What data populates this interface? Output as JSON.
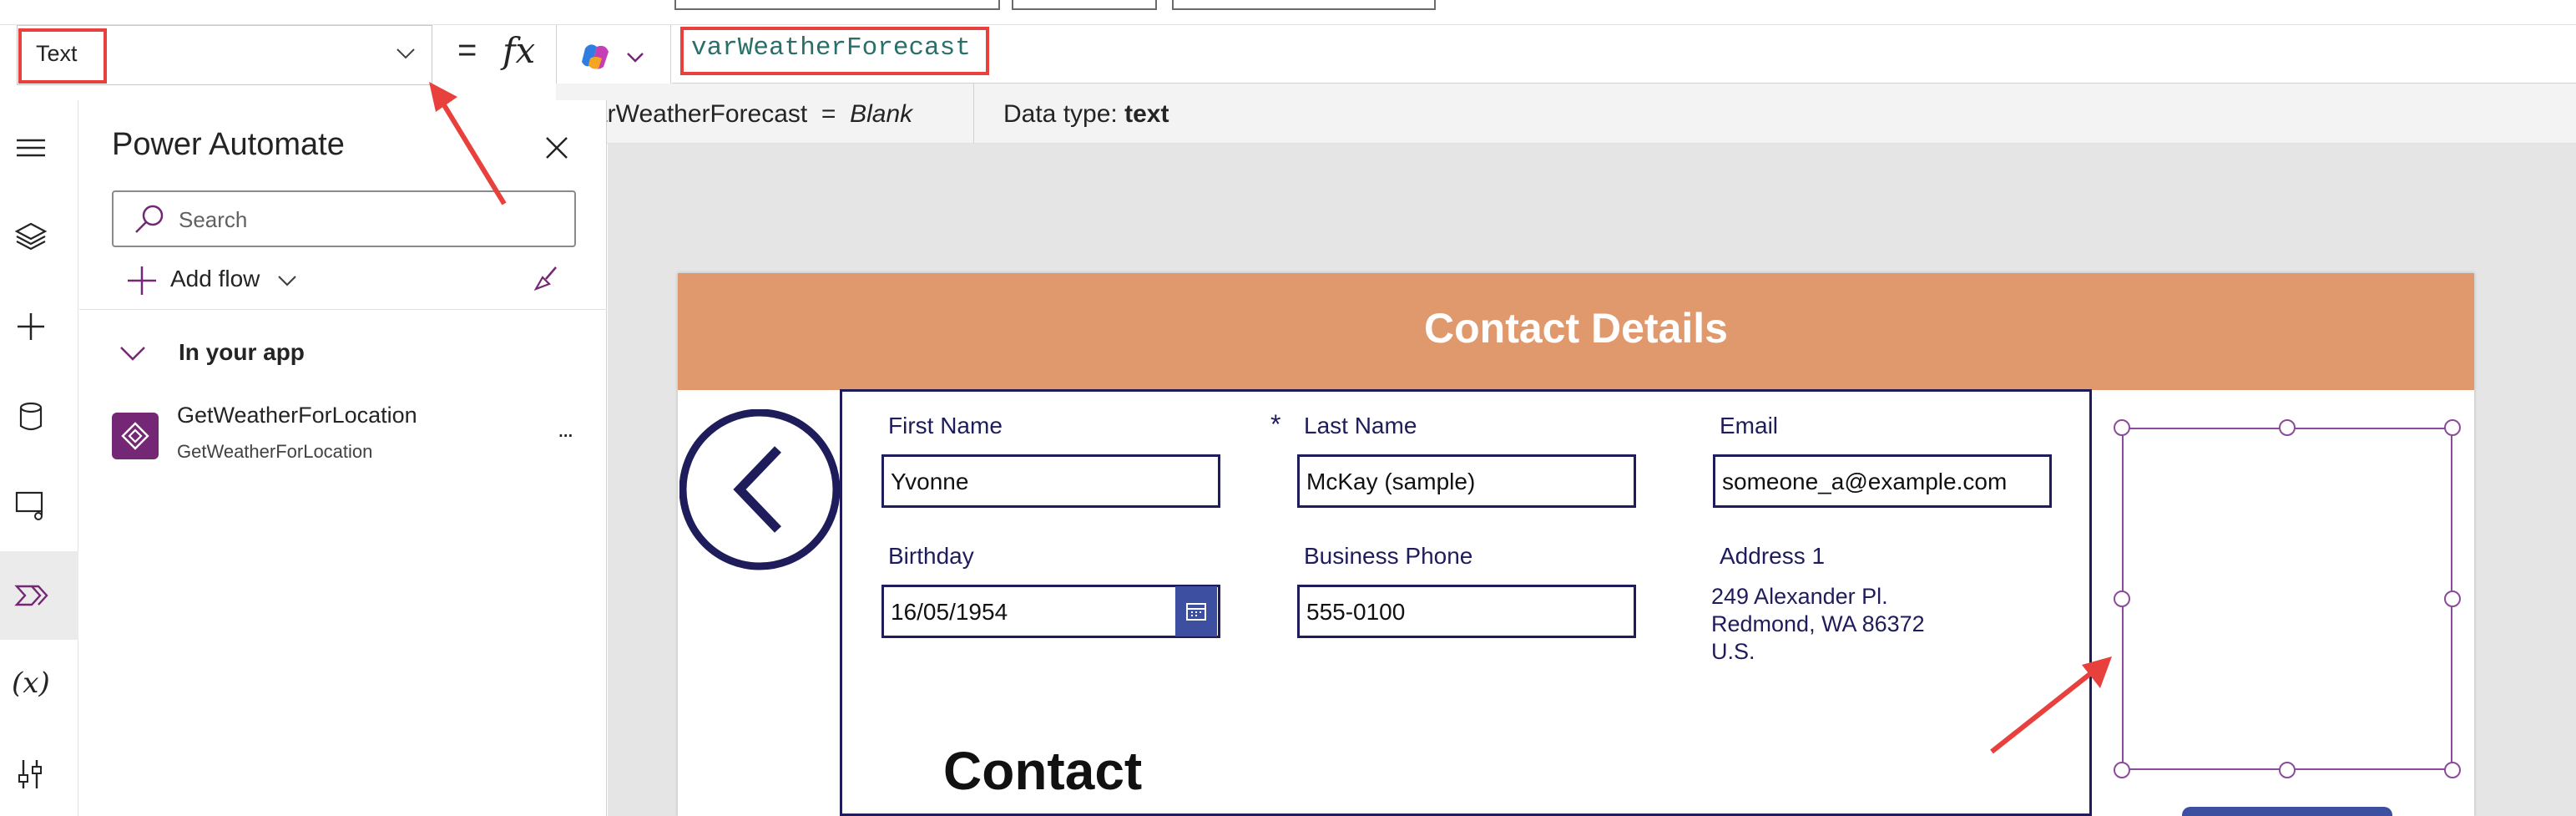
{
  "formula_bar": {
    "property_selected": "Text",
    "equals": "=",
    "fx": "fx",
    "formula": "varWeatherForecast"
  },
  "info_bar": {
    "variable_name": "varWeatherForecast",
    "equals": "=",
    "value": "Blank",
    "data_type_label": "Data type:",
    "data_type_value": "text"
  },
  "pane": {
    "title": "Power Automate",
    "search_placeholder": "Search",
    "add_flow_label": "Add flow",
    "section_label": "In your app",
    "flows": [
      {
        "name": "GetWeatherForLocation",
        "subtitle": "GetWeatherForLocation",
        "more": "..."
      }
    ]
  },
  "left_rail": {
    "items": [
      "menu-icon",
      "layers-icon",
      "insert-icon",
      "data-icon",
      "media-icon",
      "power-automate-icon",
      "variables-icon",
      "tools-icon"
    ],
    "active": "power-automate-icon"
  },
  "canvas": {
    "header_title": "Contact Details",
    "fields": {
      "first_name": {
        "label": "First Name",
        "value": "Yvonne"
      },
      "last_name": {
        "label": "Last Name",
        "value": "McKay (sample)",
        "required_mark": "*"
      },
      "email": {
        "label": "Email",
        "value": "someone_a@example.com"
      },
      "birthday": {
        "label": "Birthday",
        "value": "16/05/1954"
      },
      "business_phone": {
        "label": "Business Phone",
        "value": "555-0100"
      },
      "address1": {
        "label": "Address 1",
        "lines": [
          "249 Alexander Pl.",
          "Redmond, WA 86372",
          "U.S."
        ]
      }
    },
    "bottom_heading": "Contact"
  },
  "colors": {
    "header": "#e0996c",
    "form_border": "#1f1c5c",
    "annotation_red": "#e8413d",
    "selection": "#8c4a9c",
    "flow_icon": "#742774"
  }
}
